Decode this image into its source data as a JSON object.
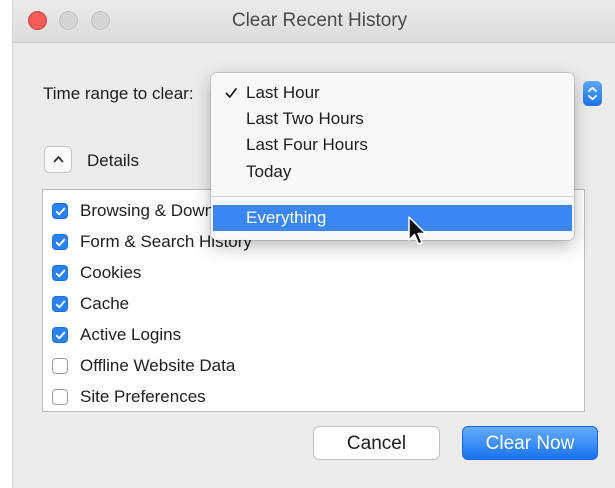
{
  "window": {
    "title": "Clear Recent History"
  },
  "time_range": {
    "label": "Time range to clear:",
    "menu": {
      "items": [
        "Last Hour",
        "Last Two Hours",
        "Last Four Hours",
        "Today"
      ],
      "checked_item": "Last Hour",
      "highlighted_item": "Everything"
    }
  },
  "details": {
    "label": "Details",
    "items": [
      {
        "label": "Browsing & Download History",
        "checked": true
      },
      {
        "label": "Form & Search History",
        "checked": true
      },
      {
        "label": "Cookies",
        "checked": true
      },
      {
        "label": "Cache",
        "checked": true
      },
      {
        "label": "Active Logins",
        "checked": true
      },
      {
        "label": "Offline Website Data",
        "checked": false
      },
      {
        "label": "Site Preferences",
        "checked": false
      }
    ]
  },
  "buttons": {
    "cancel": "Cancel",
    "clear_now": "Clear Now"
  },
  "colors": {
    "accent": "#2a82f1",
    "close_light": "#f35c58",
    "menu_highlight": "#3a86f2"
  },
  "icons": [
    "close-light-icon",
    "chevron-up-icon",
    "popup-stepper-icon",
    "checkmark-icon",
    "mouse-pointer-icon"
  ]
}
